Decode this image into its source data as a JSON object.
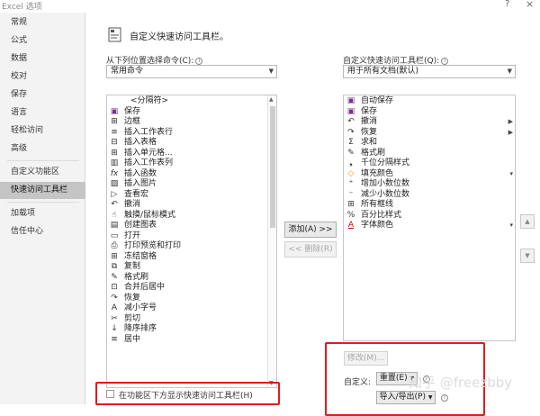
{
  "window": {
    "title": "Excel 选项",
    "help": "?",
    "close": "×"
  },
  "nav": {
    "items": [
      {
        "label": "常规"
      },
      {
        "label": "公式"
      },
      {
        "label": "数据"
      },
      {
        "label": "校对"
      },
      {
        "label": "保存"
      },
      {
        "label": "语言"
      },
      {
        "label": "轻松访问"
      },
      {
        "label": "高级"
      },
      {
        "label": "自定义功能区"
      },
      {
        "label": "快速访问工具栏",
        "selected": true
      },
      {
        "label": "加载项"
      },
      {
        "label": "信任中心"
      }
    ]
  },
  "main": {
    "title": "自定义快速访问工具栏。",
    "choose_label": "从下列位置选择命令(C):",
    "choose_value": "常用命令",
    "customize_label": "自定义快速访问工具栏(Q):",
    "customize_value": "用于所有文档(默认)",
    "left_list": [
      {
        "icon": "",
        "label": "<分隔符>"
      },
      {
        "icon": "▣",
        "label": "保存"
      },
      {
        "icon": "⊞",
        "label": "边框",
        "submenu": "▶"
      },
      {
        "icon": "≡",
        "label": "插入工作表行"
      },
      {
        "icon": "⊟",
        "label": "插入表格"
      },
      {
        "icon": "⊞",
        "label": "插入单元格..."
      },
      {
        "icon": "▥",
        "label": "插入工作表列"
      },
      {
        "icon": "fx",
        "label": "插入函数"
      },
      {
        "icon": "▨",
        "label": "插入图片"
      },
      {
        "icon": "▷",
        "label": "查看宏"
      },
      {
        "icon": "↶",
        "label": "撤消",
        "submenu": "▶"
      },
      {
        "icon": "☝",
        "label": "触摸/鼠标模式",
        "submenu": "▾"
      },
      {
        "icon": "▤",
        "label": "创建图表"
      },
      {
        "icon": "▭",
        "label": "打开"
      },
      {
        "icon": "⎙",
        "label": "打印预览和打印"
      },
      {
        "icon": "⊞",
        "label": "冻结窗格",
        "submenu": "▾"
      },
      {
        "icon": "⧉",
        "label": "复制"
      },
      {
        "icon": "✎",
        "label": "格式刷"
      },
      {
        "icon": "⊡",
        "label": "合并后居中"
      },
      {
        "icon": "↷",
        "label": "恢复",
        "submenu": "▶"
      },
      {
        "icon": "A",
        "label": "减小字号"
      },
      {
        "icon": "✂",
        "label": "剪切"
      },
      {
        "icon": "↓",
        "label": "降序排序"
      },
      {
        "icon": "≡",
        "label": "居中"
      }
    ],
    "right_list": [
      {
        "icon": "▣",
        "label": "自动保存"
      },
      {
        "icon": "▣",
        "label": "保存"
      },
      {
        "icon": "↶",
        "label": "撤消",
        "submenu": "▶"
      },
      {
        "icon": "↷",
        "label": "恢复",
        "submenu": "▶"
      },
      {
        "icon": "Σ",
        "label": "求和"
      },
      {
        "icon": "✎",
        "label": "格式刷"
      },
      {
        "icon": "❟",
        "label": "千位分隔样式"
      },
      {
        "icon": "◇",
        "label": "填充颜色",
        "submenu": "▾"
      },
      {
        "icon": "⁺",
        "label": "增加小数位数"
      },
      {
        "icon": "⁻",
        "label": "减少小数位数"
      },
      {
        "icon": "⊞",
        "label": "所有框线"
      },
      {
        "icon": "%",
        "label": "百分比样式"
      },
      {
        "icon": "A",
        "label": "字体颜色",
        "submenu": "▾"
      }
    ],
    "add_button": "添加(A) >>",
    "remove_button": "<< 删除(R)",
    "modify_button": "修改(M)...",
    "customize_label2": "自定义:",
    "reset_button": "重置(E)",
    "import_export_button": "导入/导出(P)",
    "show_below_ribbon": "在功能区下方显示快速访问工具栏(H)",
    "watermark": "知乎 @freezbby"
  },
  "colors": {
    "highlight": "#e21b1b",
    "nav_selected": "#c5c5c5",
    "save_icon": "#7b2f8f"
  }
}
